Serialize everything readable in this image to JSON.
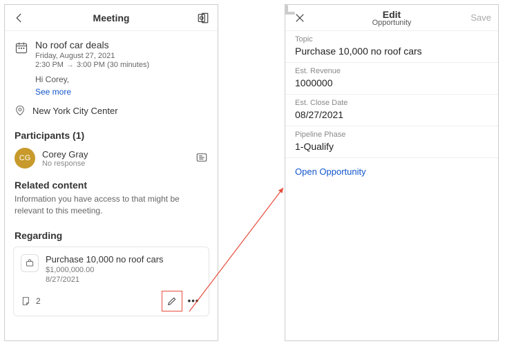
{
  "left": {
    "title": "Meeting",
    "meeting": {
      "subject": "No roof car deals",
      "date": "Friday, August 27, 2021",
      "start": "2:30 PM",
      "end": "3:00 PM",
      "duration": "(30 minutes)",
      "greeting": "Hi Corey,",
      "see_more": "See more",
      "location": "New York City Center"
    },
    "participants_heading": "Participants (1)",
    "participant": {
      "initials": "CG",
      "name": "Corey Gray",
      "status": "No response"
    },
    "related_heading": "Related content",
    "related_desc": "Information you have access to that might be relevant to this meeting.",
    "regarding_heading": "Regarding",
    "regarding": {
      "title": "Purchase 10,000 no roof cars",
      "revenue": "$1,000,000.00",
      "date": "8/27/2021",
      "notes_count": "2"
    }
  },
  "right": {
    "title": "Edit",
    "subtitle": "Opportunity",
    "save": "Save",
    "fields": {
      "topic_label": "Topic",
      "topic_value": "Purchase 10,000 no roof cars",
      "rev_label": "Est. Revenue",
      "rev_value": "1000000",
      "close_label": "Est. Close Date",
      "close_value": "08/27/2021",
      "phase_label": "Pipeline Phase",
      "phase_value": "1-Qualify"
    },
    "open_link": "Open Opportunity"
  }
}
